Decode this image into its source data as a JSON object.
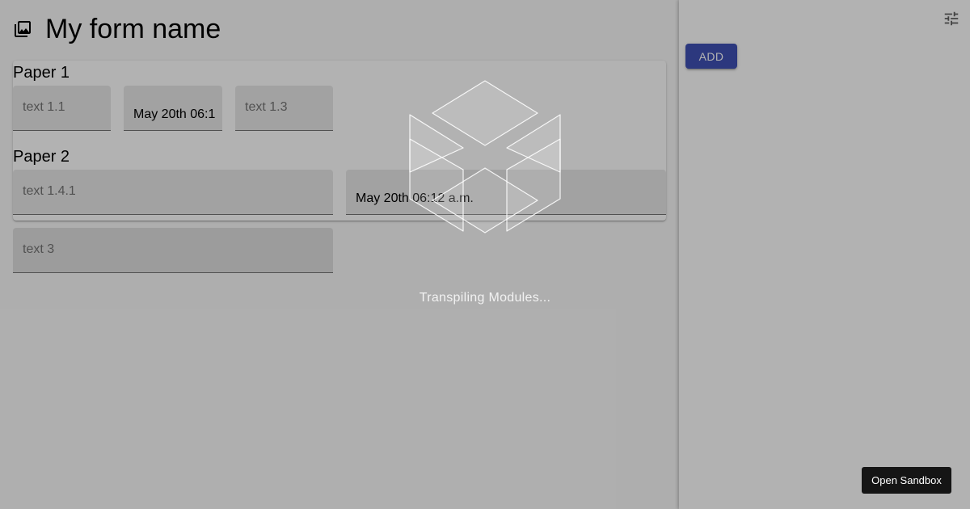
{
  "header": {
    "title": "My form name",
    "icon": "photo-library-icon"
  },
  "papers": [
    {
      "title": "Paper 1",
      "fields": [
        {
          "placeholder": "text 1.1",
          "value": ""
        },
        {
          "placeholder": "",
          "value": "May 20th 06:1"
        },
        {
          "placeholder": "text 1.3",
          "value": ""
        }
      ]
    },
    {
      "title": "Paper 2",
      "fields": [
        {
          "placeholder": "text 1.4.1",
          "value": ""
        },
        {
          "placeholder": "",
          "value": "May 20th 06:12 a.m."
        }
      ]
    }
  ],
  "standalone_field": {
    "placeholder": "text 3"
  },
  "sidebar": {
    "add_label": "ADD",
    "settings_icon": "tune-icon"
  },
  "loader": {
    "text": "Transpiling Modules...",
    "icon": "codesandbox-cube-icon"
  },
  "sandbox_button": {
    "label": "Open Sandbox"
  },
  "colors": {
    "primary": "#3f51b5",
    "overlay": "rgba(0,0,0,0.30)",
    "button_dark": "#151515"
  }
}
